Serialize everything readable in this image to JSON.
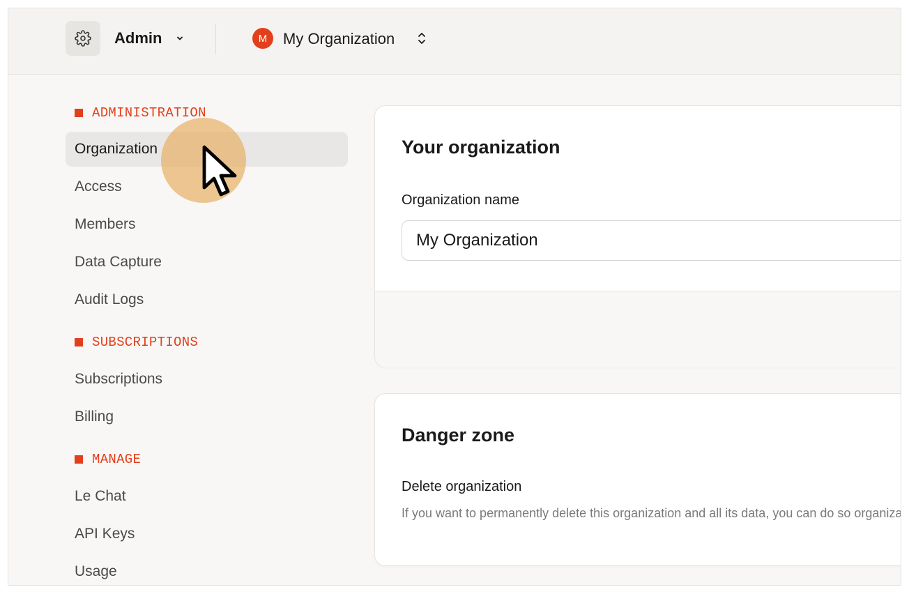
{
  "topbar": {
    "workspace_label": "Admin",
    "org_initial": "M",
    "org_name": "My Organization"
  },
  "sidebar": {
    "sections": [
      {
        "header": "ADMINISTRATION",
        "items": [
          "Organization",
          "Access",
          "Members",
          "Data Capture",
          "Audit Logs"
        ]
      },
      {
        "header": "SUBSCRIPTIONS",
        "items": [
          "Subscriptions",
          "Billing"
        ]
      },
      {
        "header": "MANAGE",
        "items": [
          "Le Chat",
          "API Keys",
          "Usage"
        ]
      }
    ],
    "active_item": "Organization"
  },
  "organization_card": {
    "title": "Your organization",
    "name_label": "Organization name",
    "name_value": "My Organization"
  },
  "danger_card": {
    "title": "Danger zone",
    "subtitle": "Delete organization",
    "description": "If you want to permanently delete this organization and all its data, you can do so organization."
  },
  "colors": {
    "accent": "#e2401c",
    "cursor_halo": "#e6aa5a"
  }
}
